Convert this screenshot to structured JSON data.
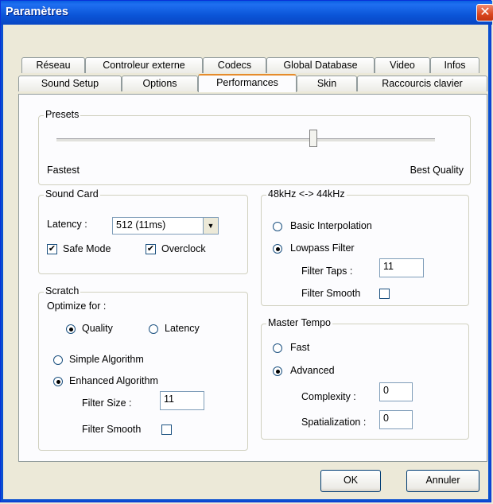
{
  "window": {
    "title": "Paramètres",
    "close_glyph": "✕"
  },
  "tabs": {
    "row1": [
      "Réseau",
      "Controleur externe",
      "Codecs",
      "Global Database",
      "Video",
      "Infos"
    ],
    "row2": [
      "Sound Setup",
      "Options",
      "Performances",
      "Skin",
      "Raccourcis clavier"
    ],
    "active": "Performances"
  },
  "presets": {
    "label": "Presets",
    "min_label": "Fastest",
    "max_label": "Best Quality",
    "level": 0.67
  },
  "sound_card": {
    "label": "Sound Card",
    "latency_label": "Latency :",
    "latency_value": "512 (11ms)",
    "safe_mode_label": "Safe Mode",
    "safe_mode_checked": true,
    "overclock_label": "Overclock",
    "overclock_checked": true
  },
  "scratch": {
    "label": "Scratch",
    "optimize_label": "Optimize for :",
    "quality_label": "Quality",
    "latency_label": "Latency",
    "simple_label": "Simple Algorithm",
    "enhanced_label": "Enhanced Algorithm",
    "filter_size_label": "Filter Size :",
    "filter_size_value": "11",
    "filter_smooth_label": "Filter Smooth"
  },
  "resample": {
    "label": "48kHz <-> 44kHz",
    "basic_label": "Basic Interpolation",
    "lowpass_label": "Lowpass Filter",
    "filter_taps_label": "Filter Taps :",
    "filter_taps_value": "11",
    "filter_smooth_label": "Filter Smooth"
  },
  "master_tempo": {
    "label": "Master Tempo",
    "fast_label": "Fast",
    "advanced_label": "Advanced",
    "complexity_label": "Complexity :",
    "complexity_value": "0",
    "spatialization_label": "Spatialization :",
    "spatialization_value": "0"
  },
  "buttons": {
    "ok": "OK",
    "cancel": "Annuler"
  },
  "colors": {
    "titlebar": "#0a5fe0",
    "close": "#d9461e",
    "face": "#ece9d8",
    "active_tab_accent": "#e68b2c"
  }
}
